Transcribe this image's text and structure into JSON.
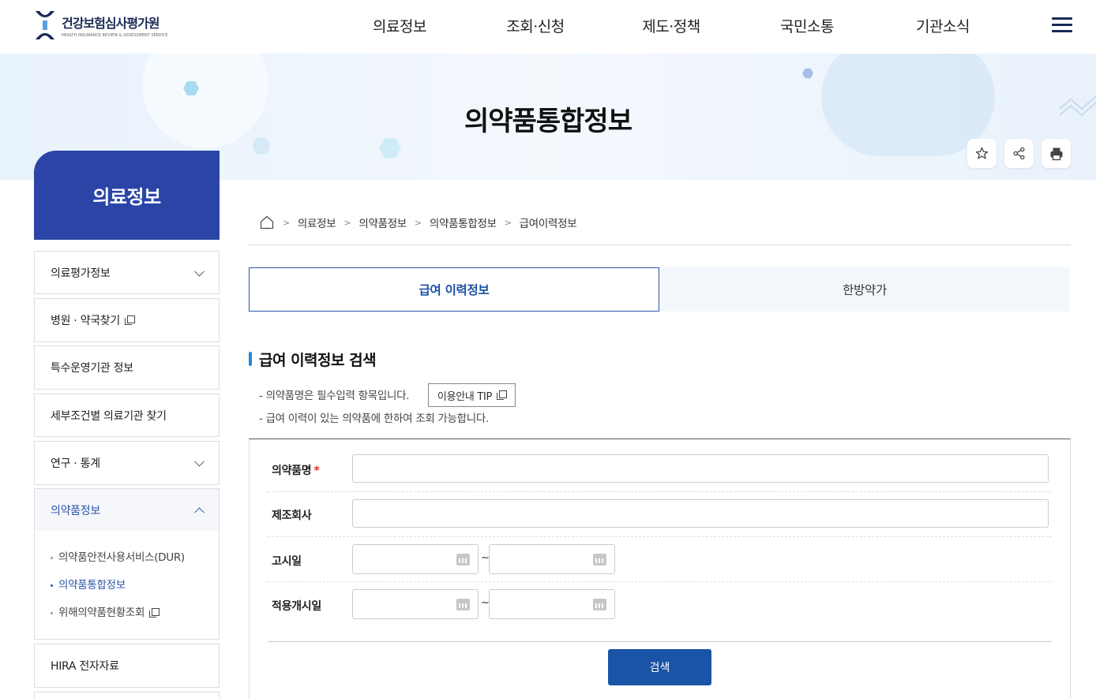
{
  "header": {
    "logo_name": "건강보험심사평가원",
    "logo_sub": "HEALTH INSURANCE REVIEW & ASSESSMENT SERVICE",
    "nav": [
      "의료정보",
      "조회·신청",
      "제도·정책",
      "국민소통",
      "기관소식"
    ]
  },
  "hero": {
    "title": "의약품통합정보"
  },
  "sidebar": {
    "title": "의료정보",
    "items": [
      {
        "label": "의료평가정보"
      },
      {
        "label": "병원 · 약국찾기"
      },
      {
        "label": "특수운영기관 정보"
      },
      {
        "label": "세부조건별 의료기관 찾기"
      },
      {
        "label": "연구 · 통계"
      },
      {
        "label": "의약품정보"
      },
      {
        "label": "HIRA 전자자료"
      }
    ],
    "sub_items": [
      {
        "label": "의약품안전사용서비스(DUR)"
      },
      {
        "label": "의약품통합정보"
      },
      {
        "label": "위해의약품현황조회"
      }
    ]
  },
  "breadcrumb": [
    "의료정보",
    "의약품정보",
    "의약품통합정보",
    "급여이력정보"
  ],
  "tabs": [
    {
      "label": "급여 이력정보"
    },
    {
      "label": "한방약가"
    }
  ],
  "section": {
    "title": "급여 이력정보 검색",
    "note1": "- 의약품명은 필수입력 항목입니다.",
    "note2": "- 급여 이력이 있는 의약품에 한하여 조회 가능합니다.",
    "tip_button": "이용안내 TIP"
  },
  "form": {
    "drug_name_label": "의약품명",
    "required_mark": "*",
    "manufacturer_label": "제조회사",
    "notice_date_label": "고시일",
    "apply_date_label": "적용개시일",
    "tilde": "~",
    "search_button": "검색"
  },
  "colors": {
    "primary": "#1a54a6",
    "sidebar": "#2b45a6",
    "accent_bar": "#1a8ae0"
  }
}
